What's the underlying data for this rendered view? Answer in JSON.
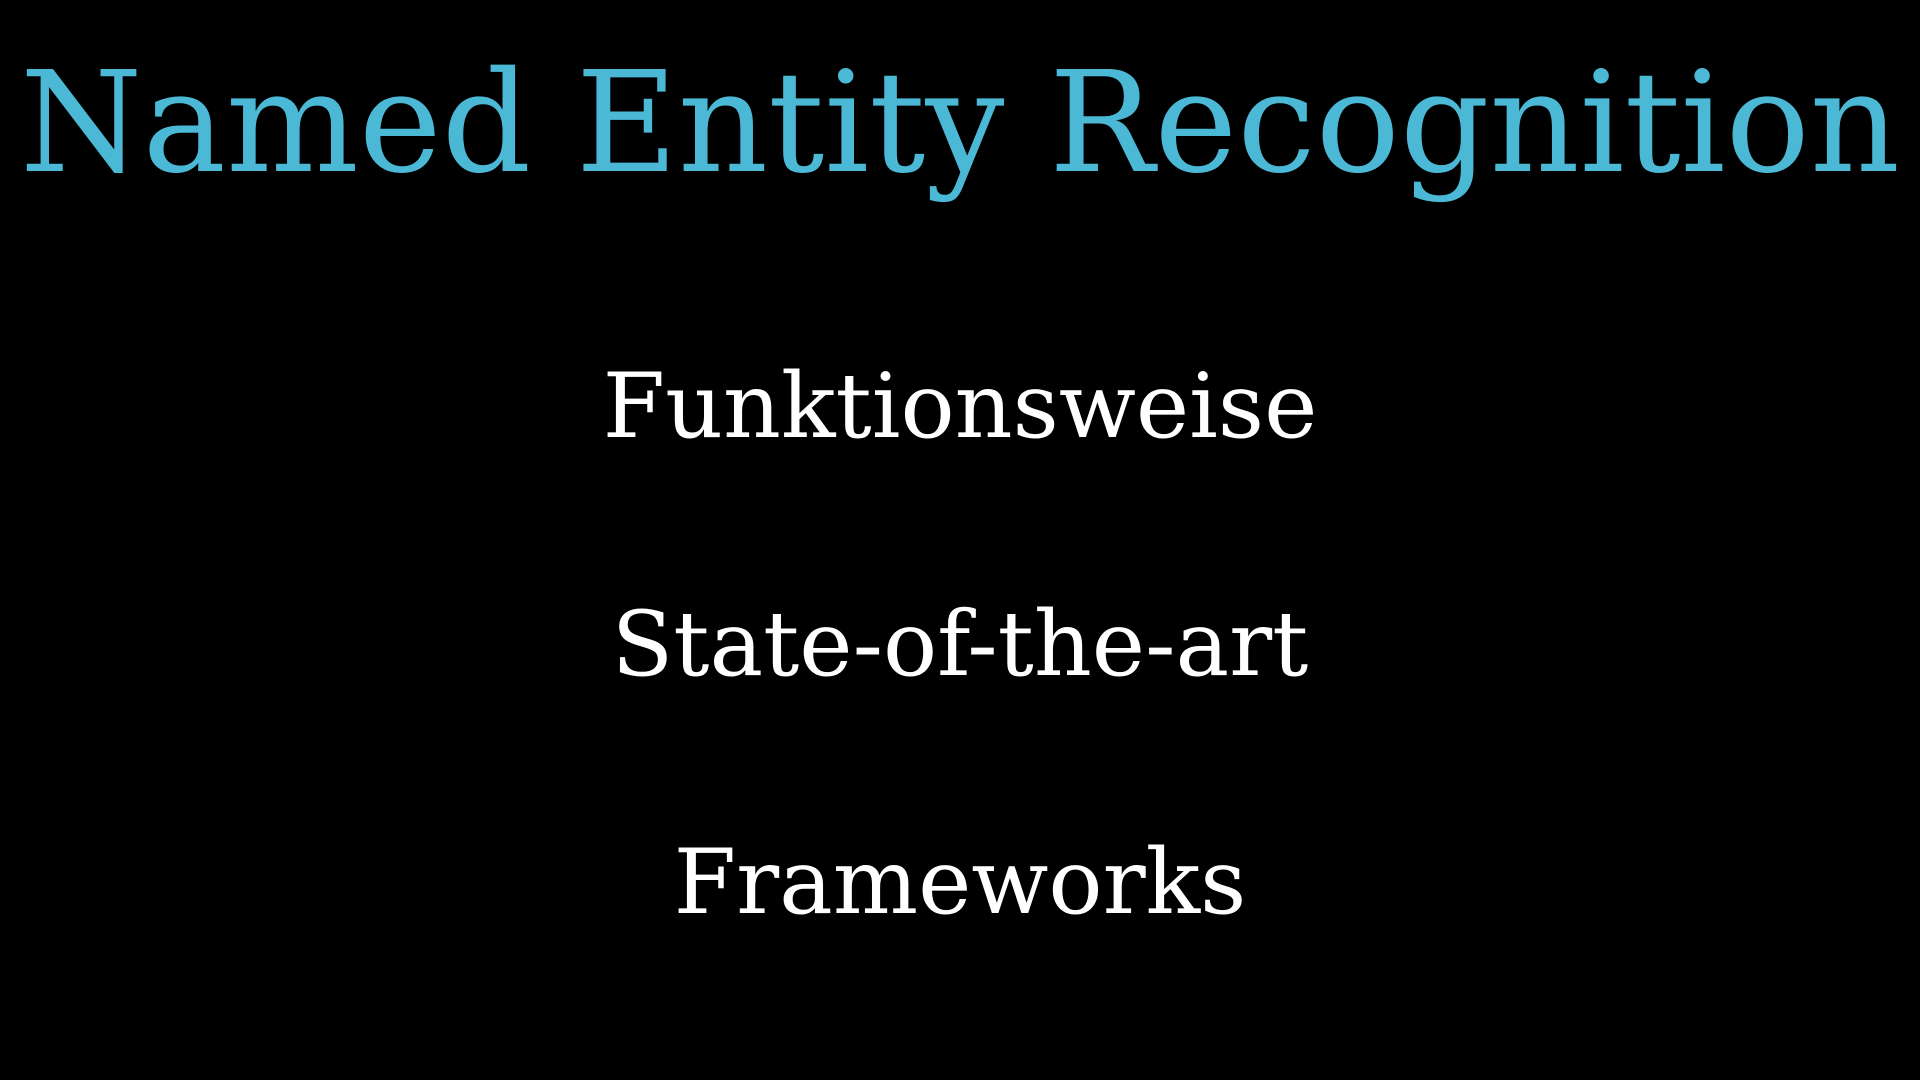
{
  "slide": {
    "title": "Named Entity Recognition",
    "title_color": "#4bb8d6",
    "text_color": "#ffffff",
    "background_color": "#000000",
    "items": [
      {
        "label": "Funktionsweise"
      },
      {
        "label": "State-of-the-art"
      },
      {
        "label": "Frameworks"
      }
    ]
  }
}
